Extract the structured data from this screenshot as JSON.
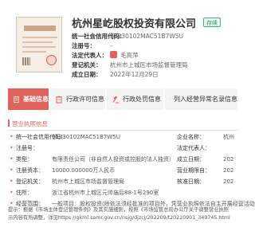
{
  "company": {
    "name": "杭州星屹股权投资有限公司",
    "status": "存续"
  },
  "summary": [
    {
      "label": "统一社会信用代码：",
      "value": "91330102MAC51B7W5U"
    },
    {
      "label": "注册号：",
      "value": "-"
    },
    {
      "label": "法定代表人：",
      "value": "毛高萍"
    },
    {
      "label": "登记机关：",
      "value": "杭州市上城区市场监督管理局"
    },
    {
      "label": "成立日期：",
      "value": "2022年12月29日"
    }
  ],
  "tabs": [
    {
      "label": "基础信息",
      "icon": "document-icon"
    },
    {
      "label": "行政许可信息",
      "icon": "clipboard-icon"
    },
    {
      "label": "行政处罚信息",
      "icon": "gavel-icon"
    },
    {
      "label": "列入经营异常名录信息",
      "icon": "warning-list-icon"
    }
  ],
  "section": {
    "title": "营业执照信息"
  },
  "details": [
    {
      "label": "统一社会信用代码：",
      "value": "91330102MAC51B7W5U",
      "label2": "企业名称：",
      "value2": "杭州"
    },
    {
      "label": "注册号：",
      "value": "",
      "label2": "法定代表人：",
      "value2": ""
    },
    {
      "label": "类型：",
      "value": "有限责任公司（非自然人投资或控股的法人独资）",
      "label2": "成立日期：",
      "value2": "202"
    },
    {
      "label": "注册资本：",
      "value": "10000.000000万人民币",
      "label2": "营业期限自：",
      "value2": "202"
    },
    {
      "label": "登记机关：",
      "value": "杭州市上城区市场监督管理局",
      "label2": "核准日期：",
      "value2": "202"
    },
    {
      "label": "住所：",
      "value": "浙江省杭州市上城区元帅庙后88-1号290室",
      "label2": "",
      "value2": ""
    },
    {
      "label": "经营范围：",
      "value": "一般项目：股权投资(除依法须经批准的项目外，凭营业执照依法自主开展经营活动)。",
      "label2": "",
      "value2": ""
    }
  ],
  "notice": [
    "提示：根据《市场主体登记管理条例》及其实施细则，按照《市场监管总局办公厅关于调整营业执照",
    "示内容有所调整，详见https://gkml.samr.gov.cn/nsjg/djzcj/202209/t20220901_349745.html"
  ],
  "colors": {
    "accent": "#e2625a",
    "status": "#1d9b64",
    "tab_bg": "#f4f4f4"
  }
}
